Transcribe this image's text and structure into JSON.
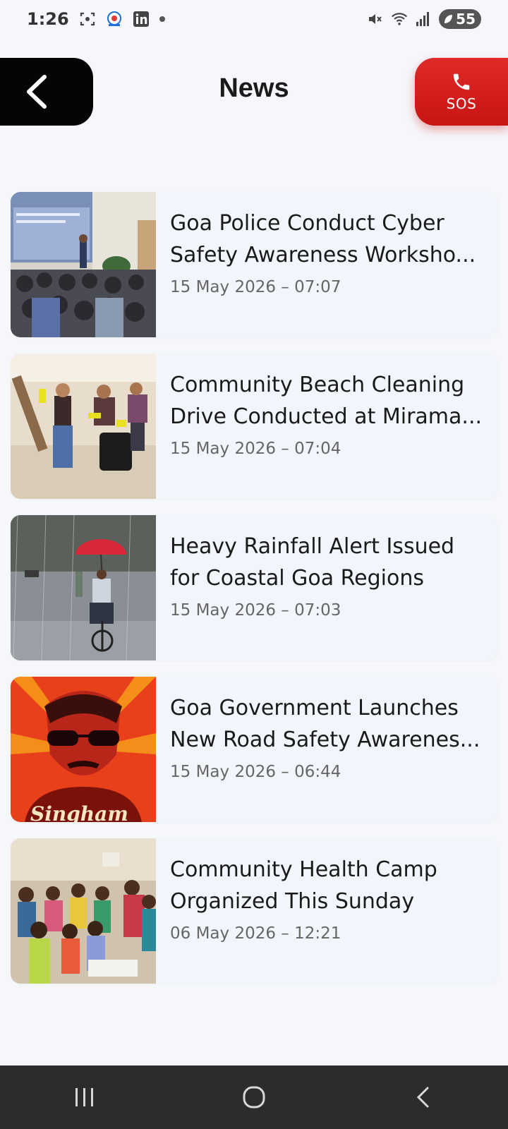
{
  "status_bar": {
    "time": "1:26",
    "battery": "55"
  },
  "header": {
    "title": "News",
    "sos_label": "SOS"
  },
  "news": [
    {
      "title": "Goa Police Conduct Cyber Safety Awareness Worksho...",
      "date": "15 May 2026 – 07:07"
    },
    {
      "title": "Community Beach Cleaning Drive Conducted at Mirama...",
      "date": "15 May 2026 – 07:04"
    },
    {
      "title": "Heavy Rainfall Alert Issued for Coastal Goa Regions",
      "date": "15 May 2026 – 07:03"
    },
    {
      "title": "Goa Government Launches New Road Safety Awarenes...",
      "date": "15 May 2026 – 06:44"
    },
    {
      "title": "Community Health Camp Organized This Sunday",
      "date": "06 May 2026 – 12:21"
    }
  ],
  "colors": {
    "sos": "#d91e1e",
    "back": "#050505",
    "background": "#f6f7fb",
    "nav_bar": "#2b2c2e"
  }
}
